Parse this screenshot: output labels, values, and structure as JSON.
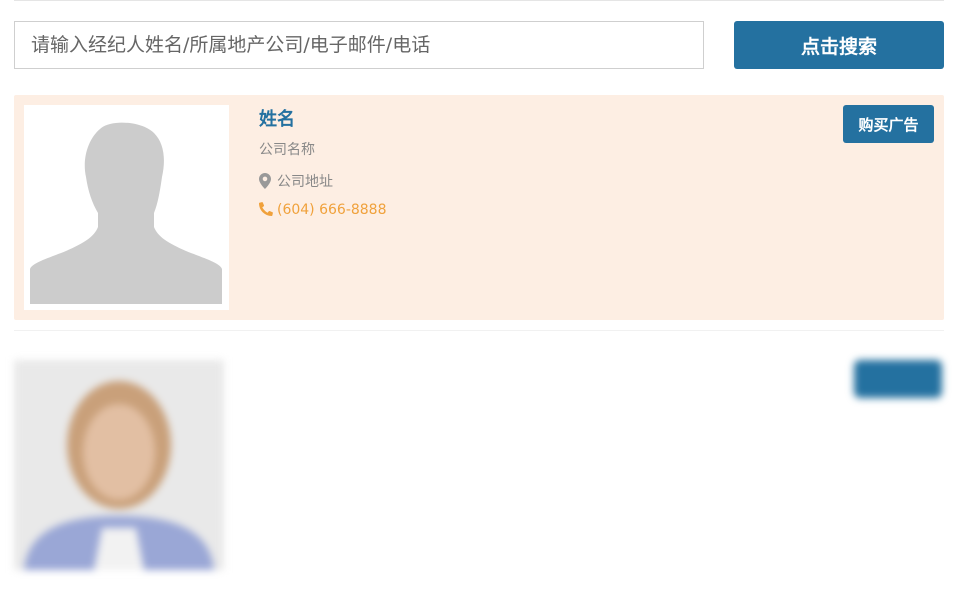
{
  "search": {
    "placeholder": "请输入经纪人姓名/所属地产公司/电子邮件/电话",
    "button_label": "点击搜索"
  },
  "featured_card": {
    "name": "姓名",
    "company": "公司名称",
    "address": "公司地址",
    "phone": "(604) 666-8888",
    "buy_ad_label": "购买广告",
    "avatar_icon": "person-silhouette-icon",
    "address_icon": "map-marker-icon",
    "phone_icon": "phone-icon"
  },
  "blurred_card": {
    "name": "",
    "company": "",
    "address": "",
    "phone": "",
    "button_label": ""
  },
  "colors": {
    "accent": "#2471a0",
    "card_bg": "#fdeee3",
    "phone": "#f0a13b",
    "muted_text": "#888888"
  }
}
